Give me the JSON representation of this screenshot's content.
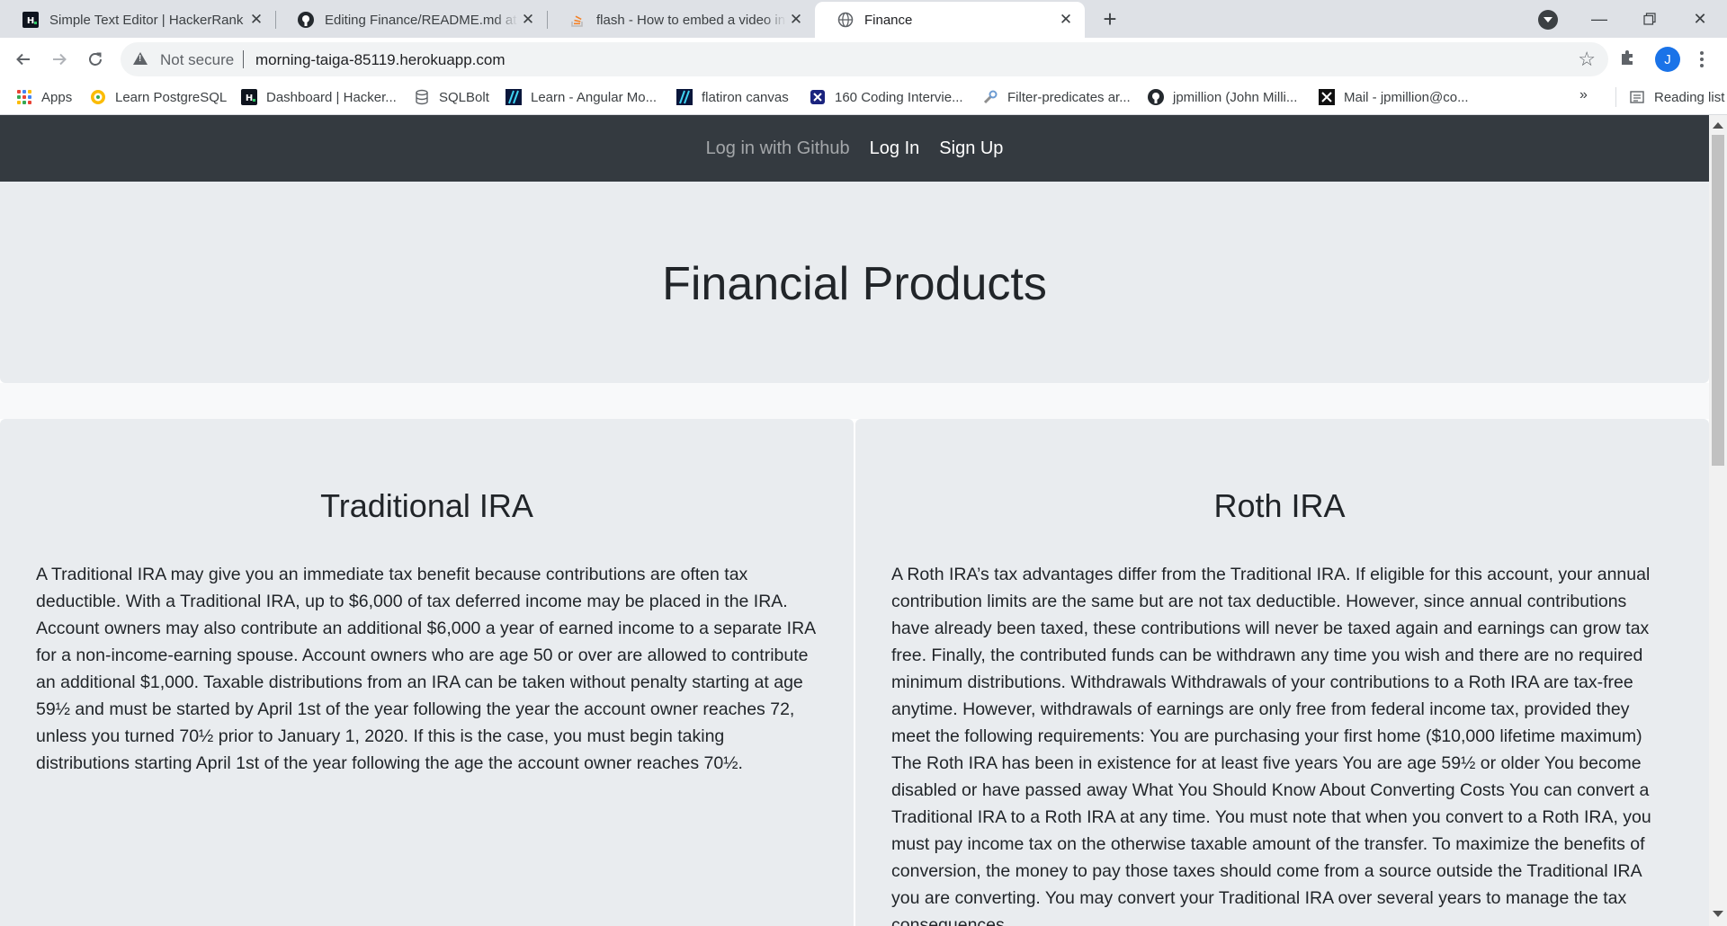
{
  "browser": {
    "tabs": [
      {
        "title": "Simple Text Editor | HackerRank",
        "icon": "hackerrank-icon",
        "active": false
      },
      {
        "title": "Editing Finance/README.md at main",
        "icon": "github-icon",
        "active": false
      },
      {
        "title": "flash - How to embed a video into",
        "icon": "stackoverflow-icon",
        "active": false
      },
      {
        "title": "Finance",
        "icon": "globe-icon",
        "active": true
      }
    ],
    "security_label": "Not secure",
    "url": "morning-taiga-85119.herokuapp.com",
    "profile_initial": "J",
    "bookmarks": [
      {
        "label": "Apps",
        "icon": "apps-grid-icon"
      },
      {
        "label": "Learn PostgreSQL",
        "icon": "postgres-icon"
      },
      {
        "label": "Dashboard | Hacker...",
        "icon": "hackerrank-icon"
      },
      {
        "label": "SQLBolt",
        "icon": "database-icon"
      },
      {
        "label": "Learn - Angular Mo...",
        "icon": "flatiron-icon"
      },
      {
        "label": "flatiron canvas",
        "icon": "flatiron-icon"
      },
      {
        "label": "160 Coding Intervie...",
        "icon": "x-box-icon"
      },
      {
        "label": "Filter-predicates ar...",
        "icon": "tool-icon"
      },
      {
        "label": "jpmillion (John Milli...",
        "icon": "github-icon"
      },
      {
        "label": "Mail - jpmillion@co...",
        "icon": "x-mail-icon"
      }
    ],
    "bookmarks_overflow": "»",
    "reading_list": "Reading list"
  },
  "page": {
    "nav": {
      "github": "Log in with Github",
      "login": "Log In",
      "signup": "Sign Up"
    },
    "heading": "Financial Products",
    "cards": [
      {
        "title": "Traditional IRA",
        "body": "A Traditional IRA may give you an immediate tax benefit because contributions are often tax deductible. With a Traditional IRA, up to $6,000 of tax deferred income may be placed in the IRA. Account owners may also contribute an additional $6,000 a year of earned income to a separate IRA for a non-income-earning spouse. Account owners who are age 50 or over are allowed to contribute an additional $1,000. Taxable distributions from an IRA can be taken without penalty starting at age 59½ and must be started by April 1st of the year following the year the account owner reaches 72, unless you turned 70½ prior to January 1, 2020. If this is the case, you must begin taking distributions starting April 1st of the year following the age the account owner reaches 70½."
      },
      {
        "title": "Roth IRA",
        "body": "A Roth IRA’s tax advantages differ from the Traditional IRA. If eligible for this account, your annual contribution limits are the same but are not tax deductible. However, since annual contributions have already been taxed, these contributions will never be taxed again and earnings can grow tax free. Finally, the contributed funds can be withdrawn any time you wish and there are no required minimum distributions. Withdrawals Withdrawals of your contributions to a Roth IRA are tax-free anytime. However, withdrawals of earnings are only free from federal income tax, provided they meet the following requirements: You are purchasing your first home ($10,000 lifetime maximum) The Roth IRA has been in existence for at least five years You are age 59½ or older You become disabled or have passed away What You Should Know About Converting Costs You can convert a Traditional IRA to a Roth IRA at any time. You must note that when you convert to a Roth IRA, you must pay income tax on the otherwise taxable amount of the transfer. To maximize the benefits of conversion, the money to pay those taxes should come from a source outside the Traditional IRA you are converting. You may convert your Traditional IRA over several years to manage the tax consequences."
      }
    ]
  }
}
